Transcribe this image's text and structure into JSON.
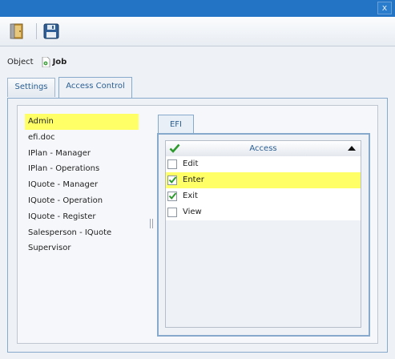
{
  "window": {
    "close_glyph": "x"
  },
  "toolbar": {
    "buttons": [
      {
        "name": "exit-door-icon"
      },
      {
        "name": "save-floppy-icon"
      }
    ]
  },
  "object_row": {
    "label": "Object",
    "icon": "job-gear-icon",
    "name": "Job"
  },
  "tabs": [
    {
      "label": "Settings",
      "active": false
    },
    {
      "label": "Access Control",
      "active": true
    }
  ],
  "roles": [
    {
      "label": "Admin",
      "selected": true
    },
    {
      "label": "efi.doc",
      "selected": false
    },
    {
      "label": "IPlan - Manager",
      "selected": false
    },
    {
      "label": "IPlan - Operations",
      "selected": false
    },
    {
      "label": "IQuote - Manager",
      "selected": false
    },
    {
      "label": "IQuote - Operation",
      "selected": false
    },
    {
      "label": "IQuote - Register",
      "selected": false
    },
    {
      "label": "Salesperson - IQuote",
      "selected": false
    },
    {
      "label": "Supervisor",
      "selected": false
    }
  ],
  "efi_tab": {
    "label": "EFI"
  },
  "access_grid": {
    "header": "Access",
    "header_icon": "green-check-icon",
    "sort": "ascending",
    "rows": [
      {
        "label": "Edit",
        "checked": false,
        "selected": false
      },
      {
        "label": "Enter",
        "checked": true,
        "selected": true
      },
      {
        "label": "Exit",
        "checked": true,
        "selected": false
      },
      {
        "label": "View",
        "checked": false,
        "selected": false
      }
    ]
  },
  "colors": {
    "titlebar": "#2474c6",
    "highlight": "#ffff66",
    "check_green": "#2e9a2e",
    "tab_text": "#2a5f93"
  }
}
